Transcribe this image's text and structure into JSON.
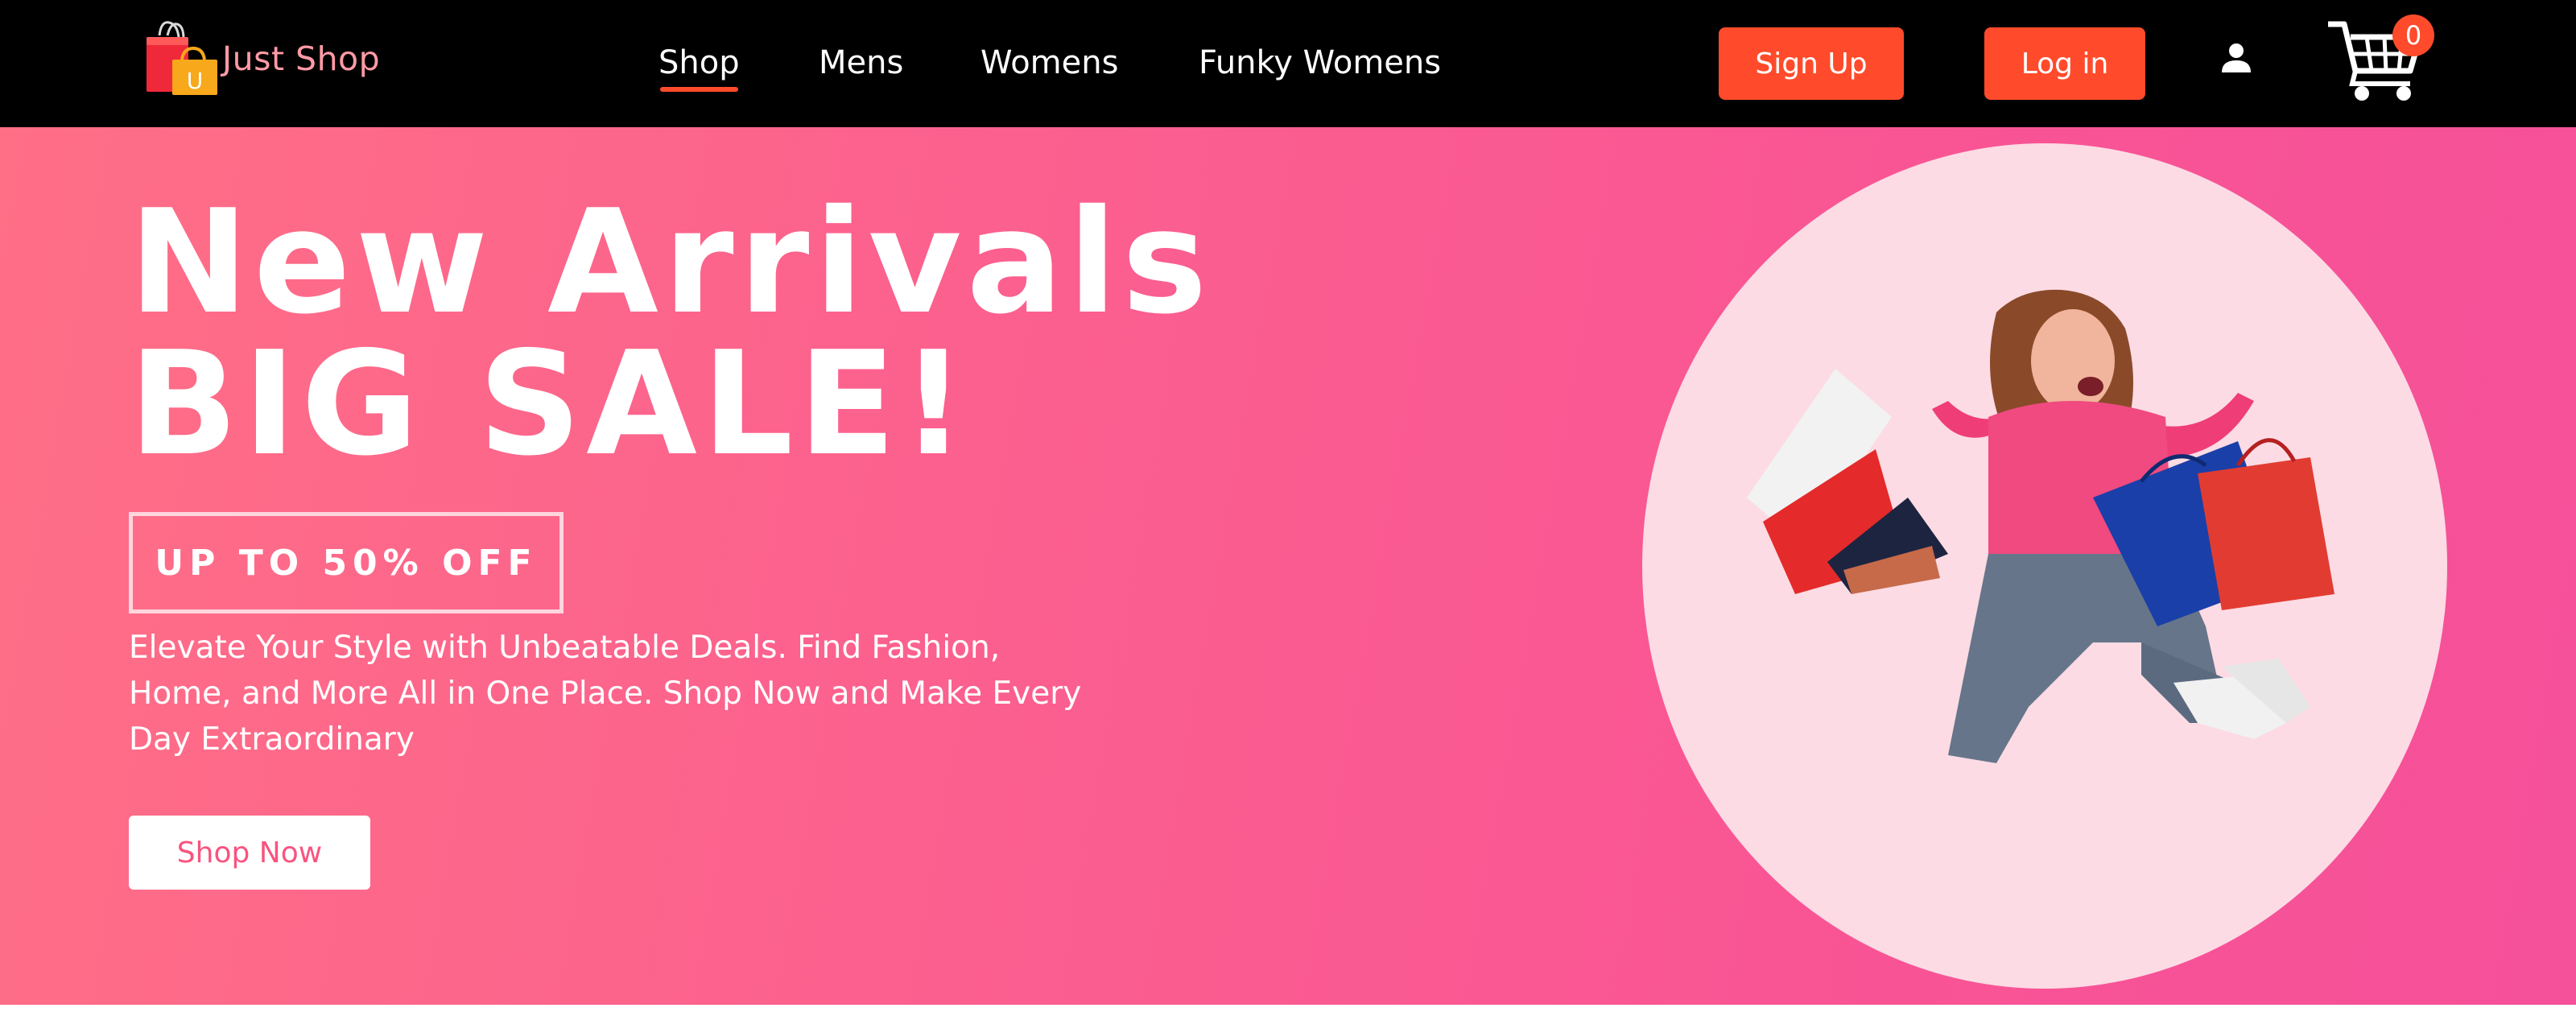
{
  "brand": {
    "name": "Just Shop",
    "logo_letter": "U"
  },
  "nav": {
    "links": [
      {
        "label": "Shop",
        "active": true
      },
      {
        "label": "Mens",
        "active": false
      },
      {
        "label": "Womens",
        "active": false
      },
      {
        "label": "Funky Womens",
        "active": false
      }
    ],
    "signup_label": "Sign Up",
    "login_label": "Log in",
    "user_icon": "user-icon",
    "cart_icon": "cart-icon",
    "cart_count": "0"
  },
  "hero": {
    "title_line1": "New Arrivals",
    "title_line2": "BIG SALE!",
    "discount": "UP TO 50% OFF",
    "description": "Elevate Your Style with Unbeatable Deals. Find Fashion, Home, and More All in One Place. Shop Now and Make Every Day Extraordinary",
    "cta_label": "Shop Now",
    "image": "woman-jumping-with-shopping-bags"
  },
  "colors": {
    "navbar_bg": "#000000",
    "accent": "#ff4b2b",
    "hero_gradient_start": "#ff6f86",
    "hero_gradient_end": "#f5509a",
    "circle_bg": "#fcdbe4",
    "brand_text": "#ff9aa6"
  }
}
